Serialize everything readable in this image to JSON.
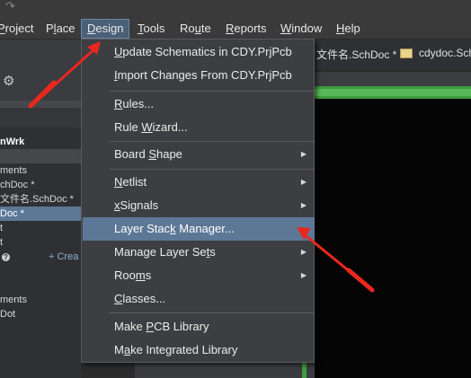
{
  "menubar": {
    "items": [
      {
        "pre": "",
        "u": "P",
        "post": "roject"
      },
      {
        "pre": "P",
        "u": "l",
        "post": "ace"
      },
      {
        "pre": "",
        "u": "D",
        "post": "esign"
      },
      {
        "pre": "",
        "u": "T",
        "post": "ools"
      },
      {
        "pre": "Ro",
        "u": "u",
        "post": "te"
      },
      {
        "pre": "",
        "u": "R",
        "post": "eports"
      },
      {
        "pre": "",
        "u": "W",
        "post": "indow"
      },
      {
        "pre": "",
        "u": "H",
        "post": "elp"
      }
    ]
  },
  "tabs": {
    "tab1": "文件名.SchDoc *",
    "tab2": "cdydoc.SchDoc"
  },
  "left_panel": {
    "workspace": "nWrk",
    "rows": [
      "ments",
      "chDoc *",
      "文件名.SchDoc *",
      "Doc *",
      "t",
      "t",
      "ments",
      "Dot"
    ],
    "create": "+ Crea",
    "help": "?"
  },
  "dropdown": {
    "items": [
      {
        "pre": "",
        "u": "U",
        "post": "pdate Schematics in CDY.PrjPcb",
        "submenu": false
      },
      {
        "pre": "",
        "u": "I",
        "post": "mport Changes From CDY.PrjPcb",
        "submenu": false
      },
      {
        "pre": "",
        "u": "R",
        "post": "ules...",
        "submenu": false
      },
      {
        "pre": "Rule ",
        "u": "W",
        "post": "izard...",
        "submenu": false
      },
      {
        "pre": "Board ",
        "u": "S",
        "post": "hape",
        "submenu": true
      },
      {
        "pre": "",
        "u": "N",
        "post": "etlist",
        "submenu": true
      },
      {
        "pre": "",
        "u": "x",
        "post": "Signals",
        "submenu": true
      },
      {
        "pre": "Layer Stac",
        "u": "k",
        "post": " Manager...",
        "submenu": false
      },
      {
        "pre": "Manage Layer Se",
        "u": "t",
        "post": "s",
        "submenu": true
      },
      {
        "pre": "Roo",
        "u": "m",
        "post": "s",
        "submenu": true
      },
      {
        "pre": "",
        "u": "C",
        "post": "lasses...",
        "submenu": false
      },
      {
        "pre": "Make ",
        "u": "P",
        "post": "CB Library",
        "submenu": false
      },
      {
        "pre": "M",
        "u": "a",
        "post": "ke Integrated Library",
        "submenu": false
      }
    ],
    "highlighted_index": 7
  },
  "colors": {
    "highlight": "#5d7796",
    "annotation": "#e8281e",
    "board_edge": "#3f9b3f"
  }
}
